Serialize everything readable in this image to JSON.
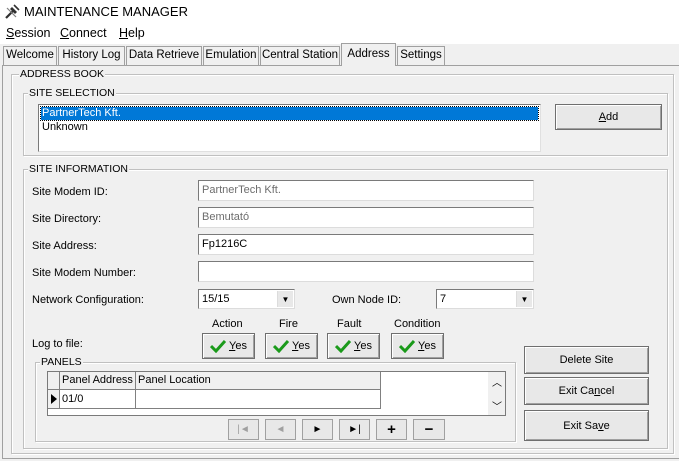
{
  "window": {
    "title": "MAINTENANCE MANAGER"
  },
  "menu": [
    {
      "label": "Session",
      "mnemonic": "S",
      "rest": "ession"
    },
    {
      "label": "Connect",
      "mnemonic": "C",
      "rest": "onnect"
    },
    {
      "label": "Help",
      "mnemonic": "H",
      "rest": "elp"
    }
  ],
  "tabs": [
    {
      "label": "Welcome"
    },
    {
      "label": "History Log"
    },
    {
      "label": "Data Retrieve"
    },
    {
      "label": "Emulation"
    },
    {
      "label": "Central Station"
    },
    {
      "label": "Address",
      "active": true
    },
    {
      "label": "Settings"
    }
  ],
  "address_book": {
    "title": "ADDRESS BOOK",
    "site_selection": {
      "title": "SITE SELECTION",
      "sites": [
        "PartnerTech Kft.",
        "Unknown"
      ],
      "selected_index": 0,
      "add_prefix": "",
      "add_mnemonic": "A",
      "add_rest": "dd"
    },
    "site_information": {
      "title": "SITE INFORMATION",
      "modem_id_label": "Site Modem ID:",
      "modem_id_value": "PartnerTech Kft.",
      "directory_label": "Site Directory:",
      "directory_value": "Bemutató",
      "address_label": "Site Address:",
      "address_value": "Fp1216C",
      "modem_number_label": "Site Modem Number:",
      "modem_number_value": "",
      "network_label": "Network Configuration:",
      "network_value": "15/15",
      "own_node_label": "Own Node ID:",
      "own_node_value": "7",
      "log_label": "Log to file:",
      "log_columns": [
        {
          "header": "Action",
          "value": "Yes",
          "mnemonic": "Y",
          "rest": "es"
        },
        {
          "header": "Fire",
          "value": "Yes",
          "mnemonic": "Y",
          "rest": "es"
        },
        {
          "header": "Fault",
          "value": "Yes",
          "mnemonic": "Y",
          "rest": "es"
        },
        {
          "header": "Condition",
          "value": "Yes",
          "mnemonic": "Y",
          "rest": "es"
        }
      ]
    },
    "panels": {
      "title": "PANELS",
      "columns": [
        "Panel Address",
        "Panel Location"
      ],
      "rows": [
        {
          "address": "01/0",
          "location": ""
        }
      ]
    },
    "navigator": [
      "|◄",
      "◄",
      "►",
      "►|",
      "+",
      "−"
    ],
    "actions": {
      "delete_site": "Delete Site",
      "exit_cancel_prefix": "Exit Ca",
      "exit_cancel_mnemonic": "n",
      "exit_cancel_rest": "cel",
      "exit_save_prefix": "Exit Sa",
      "exit_save_mnemonic": "v",
      "exit_save_rest": "e"
    }
  },
  "colors": {
    "selection": "#0078d7",
    "check": "#1a9a1a",
    "background": "#f0f0f0"
  }
}
